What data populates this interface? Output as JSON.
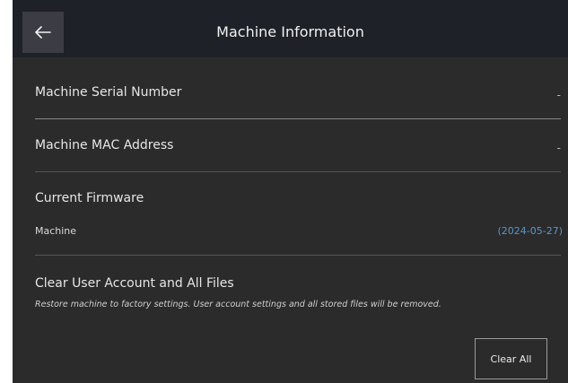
{
  "header": {
    "title": "Machine Information",
    "back_icon": "arrow-left-icon"
  },
  "serial": {
    "label": "Machine Serial Number",
    "value": "-"
  },
  "mac": {
    "label": "Machine MAC Address",
    "value": "-"
  },
  "firmware": {
    "section_label": "Current Firmware",
    "item_label": "Machine",
    "item_value": "(2024-05-27)",
    "value_color": "#5b95c9"
  },
  "clear": {
    "title": "Clear User Account and All Files",
    "description": "Restore machine to factory settings. User account settings and all stored files will be removed.",
    "button_label": "Clear All"
  },
  "colors": {
    "background": "#2b2b2b",
    "header": "#1f2129"
  }
}
